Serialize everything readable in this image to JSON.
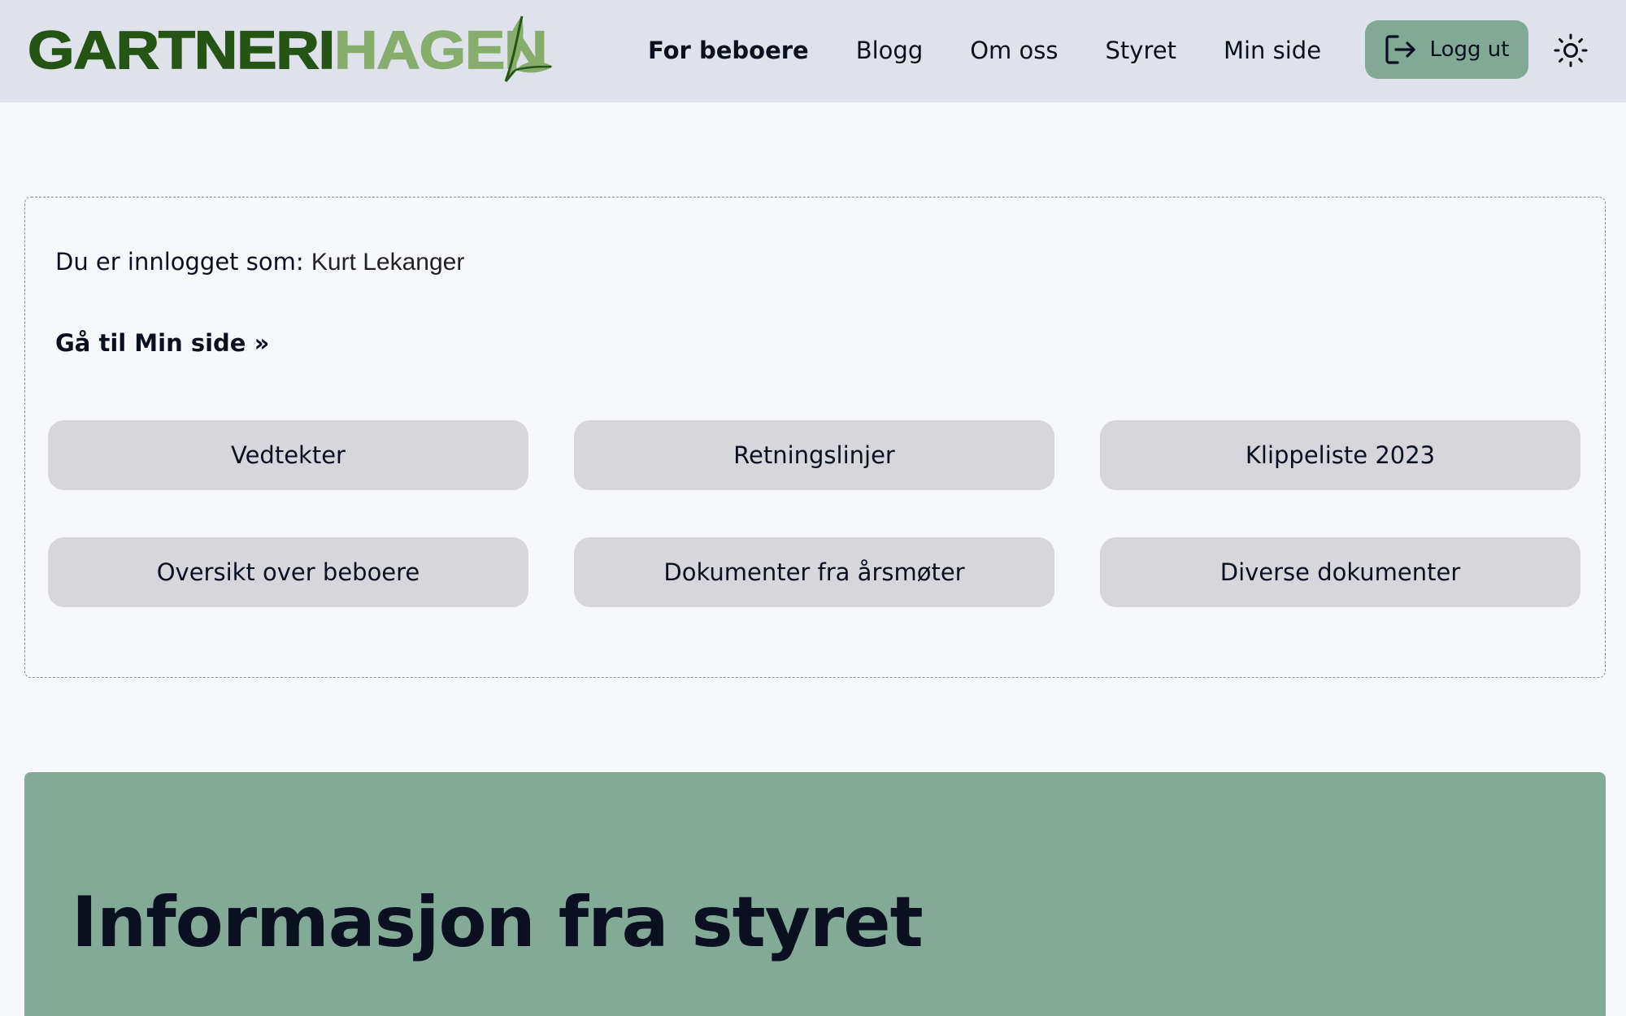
{
  "header": {
    "logo_part1": "GARTNERI",
    "logo_part2": "HAGEN",
    "nav": [
      "For beboere",
      "Blogg",
      "Om oss",
      "Styret",
      "Min side"
    ],
    "active_nav": "For beboere",
    "logout_label": "Logg ut",
    "logout_icon": "logout-icon",
    "theme_icon": "sun-icon"
  },
  "card": {
    "logged_in_label": "Du er innlogget som:",
    "user_name": "Kurt Lekanger",
    "goto_link": "Gå til Min side »",
    "buttons": [
      "Vedtekter",
      "Retningslinjer",
      "Klippeliste 2023",
      "Oversikt over beboere",
      "Dokumenter fra årsmøter",
      "Diverse dokumenter"
    ]
  },
  "info": {
    "title": "Informasjon fra styret"
  },
  "colors": {
    "header_bg": "#dfe2eb",
    "logo_dark_green": "#255415",
    "logo_light_green": "#86ad6b",
    "accent_green": "#82a995",
    "button_gray": "#d6d6db",
    "section_green": "#83aa97"
  }
}
